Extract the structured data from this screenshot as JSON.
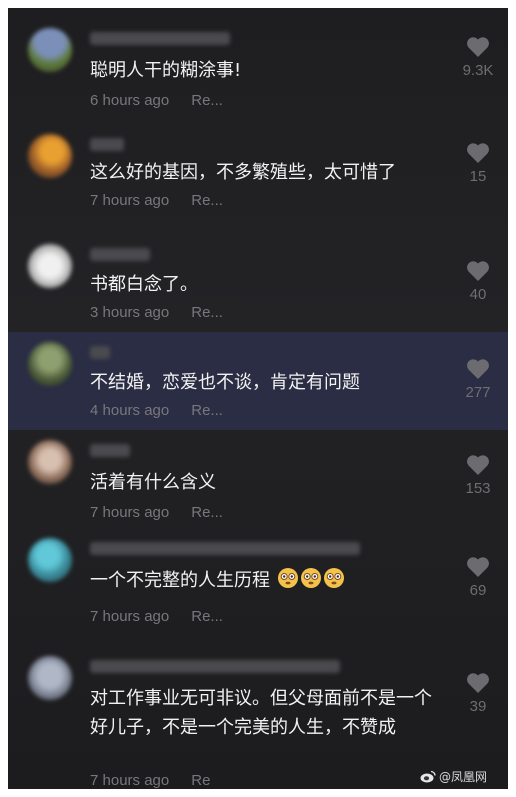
{
  "comments": [
    {
      "text": "聪明人干的糊涂事!",
      "time": "6 hours ago",
      "reply": "Re...",
      "likes": "9.3K",
      "highlighted": false
    },
    {
      "text": "这么好的基因，不多繁殖些，太可惜了",
      "time": "7 hours ago",
      "reply": "Re...",
      "likes": "15",
      "highlighted": false
    },
    {
      "text": "书都白念了。",
      "time": "3 hours ago",
      "reply": "Re...",
      "likes": "40",
      "highlighted": false
    },
    {
      "text": "不结婚，恋爱也不谈，肯定有问题",
      "time": "4 hours ago",
      "reply": "Re...",
      "likes": "277",
      "highlighted": true
    },
    {
      "text": "活着有什么含义",
      "time": "7 hours ago",
      "reply": "Re...",
      "likes": "153",
      "highlighted": false
    },
    {
      "text": "一个不完整的人生历程",
      "time": "7 hours ago",
      "reply": "Re...",
      "likes": "69",
      "highlighted": false,
      "emoji": [
        "flushed-face-icon",
        "flushed-face-icon",
        "flushed-face-icon"
      ]
    },
    {
      "text": "对工作事业无可非议。但父母面前不是一个好儿子，不是一个完美的人生，不赞成",
      "time": "7 hours ago",
      "reply": "Re",
      "likes": "39",
      "highlighted": false
    }
  ],
  "watermark": {
    "text": "@凤凰网",
    "icon": "weibo-icon"
  },
  "colors": {
    "background": "#1e1e20",
    "highlight": "#2a2d44",
    "text": "#f2f2f2",
    "meta": "#77777c"
  }
}
